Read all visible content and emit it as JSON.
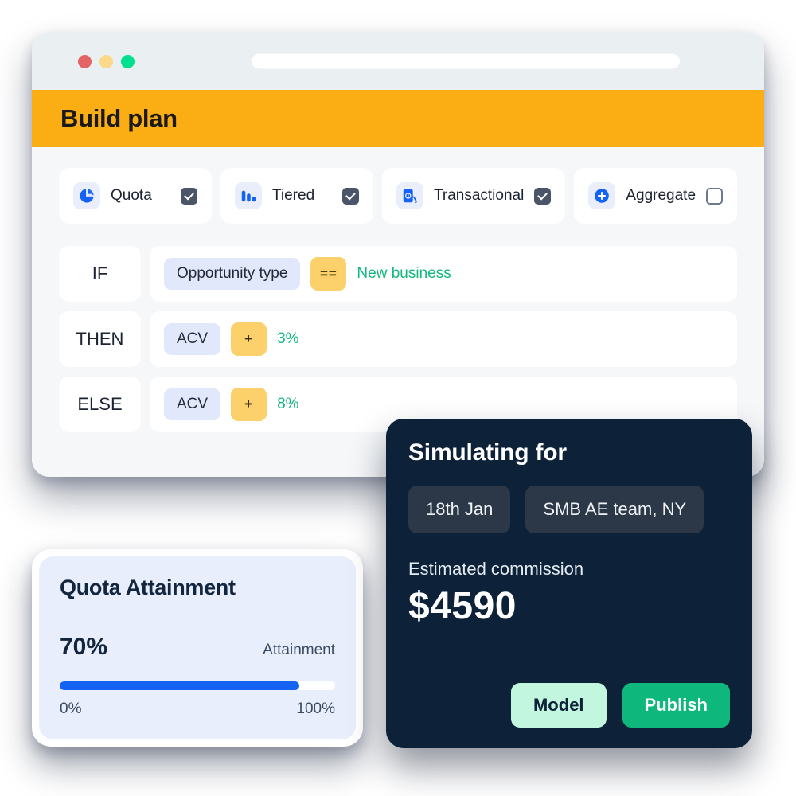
{
  "window": {
    "traffic_lights": [
      {
        "name": "close",
        "color": "#e36464"
      },
      {
        "name": "minimize",
        "color": "#fbd88a"
      },
      {
        "name": "maximize",
        "color": "#00e08f"
      }
    ],
    "url_value": ""
  },
  "header": {
    "title": "Build plan",
    "background": "#fbad14"
  },
  "plan_types": [
    {
      "label": "Quota",
      "icon": "pie-chart-icon",
      "checked": true
    },
    {
      "label": "Tiered",
      "icon": "bar-chart-icon",
      "checked": true
    },
    {
      "label": "Transactional",
      "icon": "money-hand-icon",
      "checked": true
    },
    {
      "label": "Aggregate",
      "icon": "plus-circle-icon",
      "checked": false
    }
  ],
  "rules": [
    {
      "keyword": "IF",
      "field": "Opportunity type",
      "operator": "==",
      "value": "New business"
    },
    {
      "keyword": "THEN",
      "field": "ACV",
      "operator": "+",
      "value": "3%"
    },
    {
      "keyword": "ELSE",
      "field": "ACV",
      "operator": "+",
      "value": "8%"
    }
  ],
  "quota_card": {
    "title": "Quota Attainment",
    "value_label": "70%",
    "metric_label": "Attainment",
    "scale_min": "0%",
    "scale_max": "100%",
    "fill_percent": 87,
    "fill_color": "#1463f3"
  },
  "simulation": {
    "title": "Simulating for",
    "chips": [
      "18th Jan",
      "SMB AE team, NY"
    ],
    "commission_label": "Estimated commission",
    "commission_amount": "$4590",
    "buttons": {
      "secondary": "Model",
      "primary": "Publish"
    },
    "accent_color": "#0eb87c"
  },
  "chart_data": {
    "type": "bar",
    "title": "Quota Attainment",
    "categories": [
      "Attainment"
    ],
    "values": [
      70
    ],
    "xlabel": "",
    "ylabel": "",
    "ylim": [
      0,
      100
    ],
    "tick_labels": [
      "0%",
      "100%"
    ],
    "data_labels": [
      "70%"
    ]
  }
}
